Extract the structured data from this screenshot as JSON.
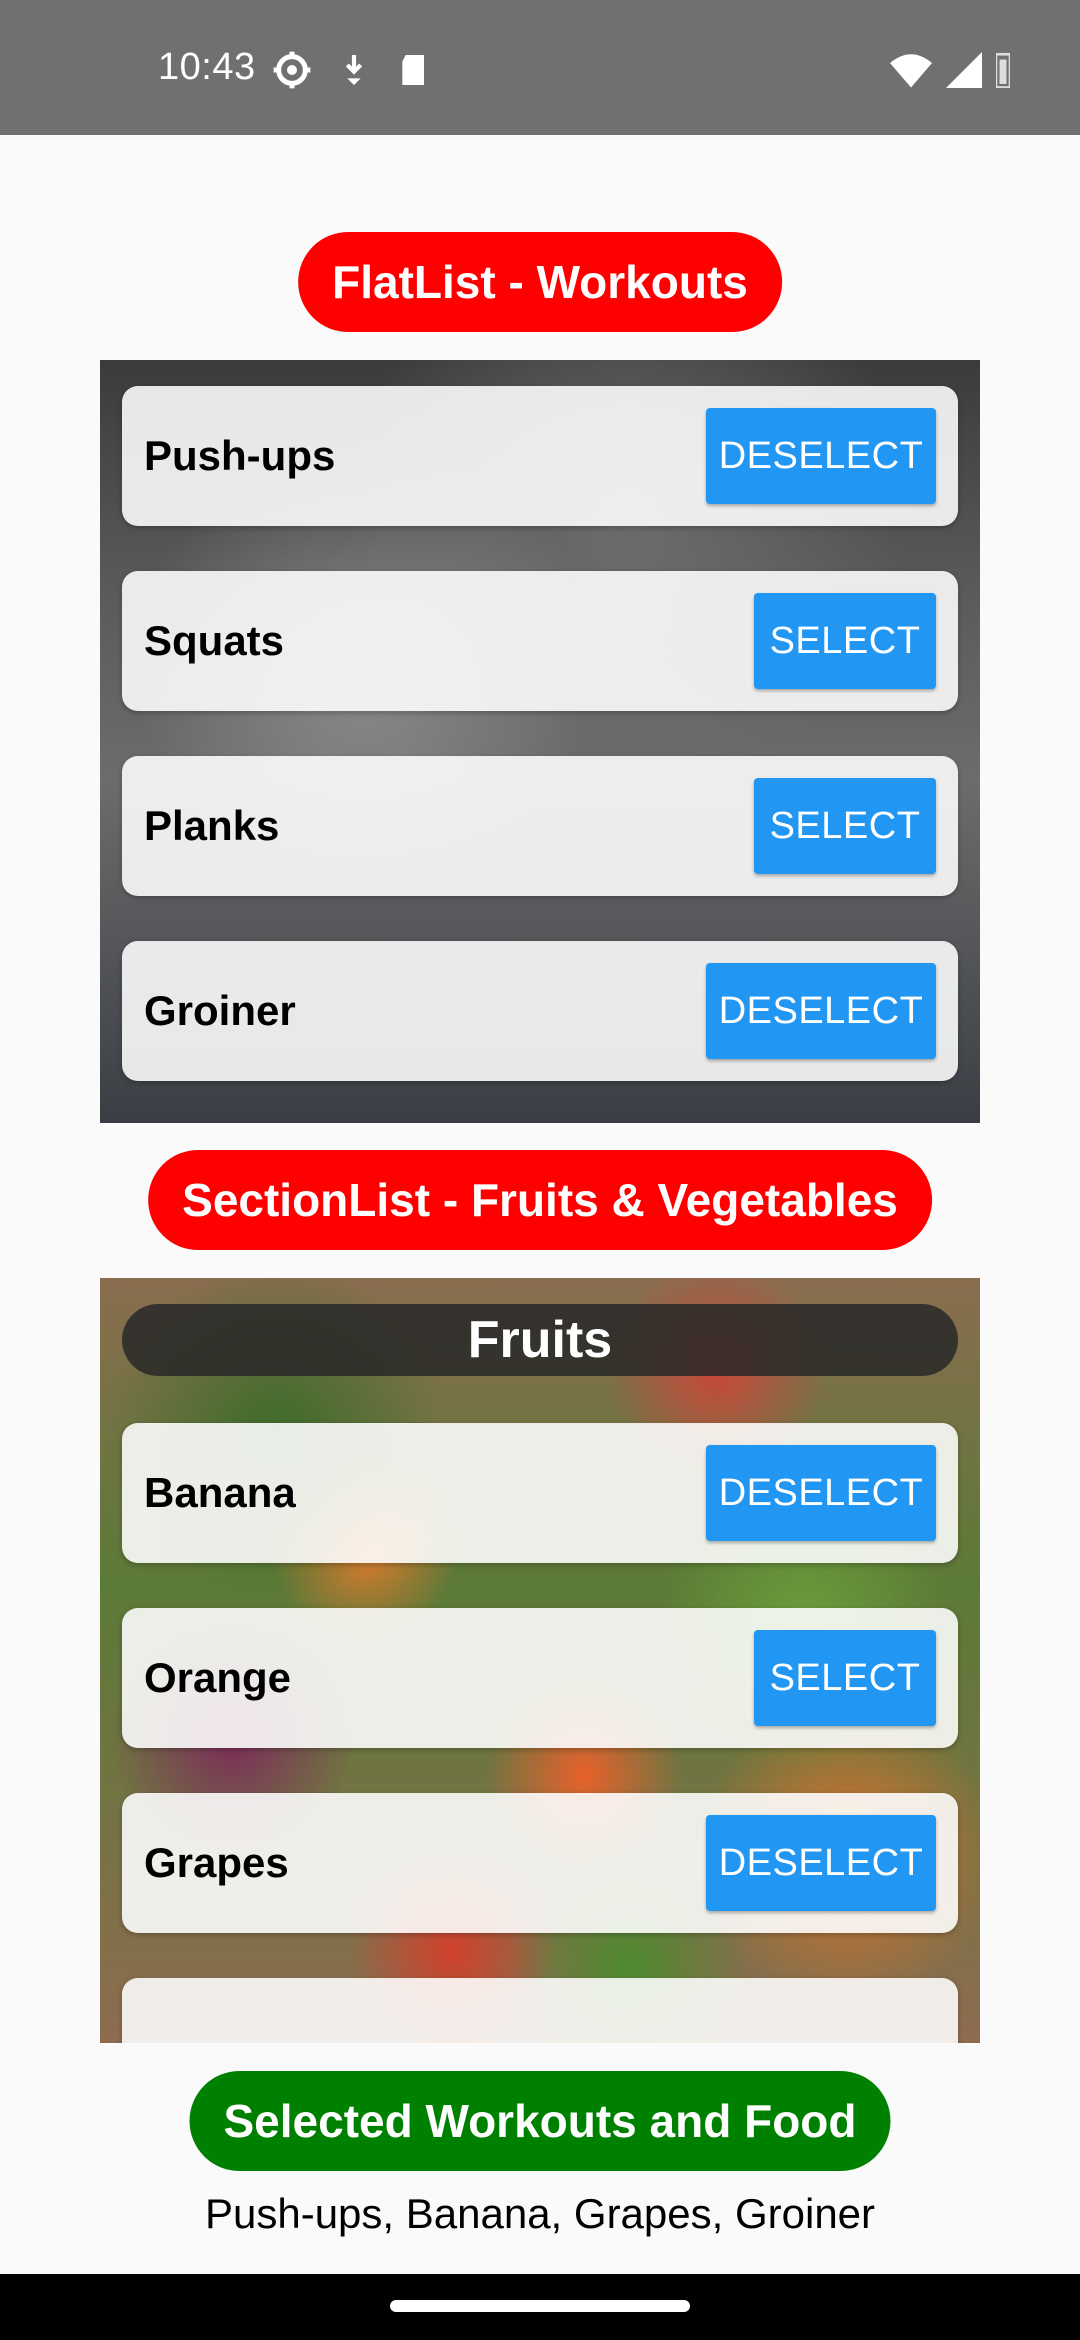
{
  "status_bar": {
    "time": "10:43",
    "icons_left": [
      "settings-icon",
      "download-icon",
      "sd-card-icon"
    ],
    "icons_right": [
      "wifi-icon",
      "cell-signal-icon",
      "battery-icon"
    ]
  },
  "flatlist": {
    "header": "FlatList - Workouts",
    "items": [
      {
        "label": "Push-ups",
        "button": "DESELECT"
      },
      {
        "label": "Squats",
        "button": "SELECT"
      },
      {
        "label": "Planks",
        "button": "SELECT"
      },
      {
        "label": "Groiner",
        "button": "DESELECT"
      }
    ]
  },
  "sectionlist": {
    "header": "SectionList - Fruits & Vegetables",
    "section_title": "Fruits",
    "items": [
      {
        "label": "Banana",
        "button": "DESELECT"
      },
      {
        "label": "Orange",
        "button": "SELECT"
      },
      {
        "label": "Grapes",
        "button": "DESELECT"
      }
    ]
  },
  "selected": {
    "header": "Selected Workouts and Food",
    "text": "Push-ups, Banana, Grapes, Groiner"
  },
  "colors": {
    "header_red": "#ff0000",
    "header_green": "#008000",
    "button_blue": "#2196f3"
  }
}
